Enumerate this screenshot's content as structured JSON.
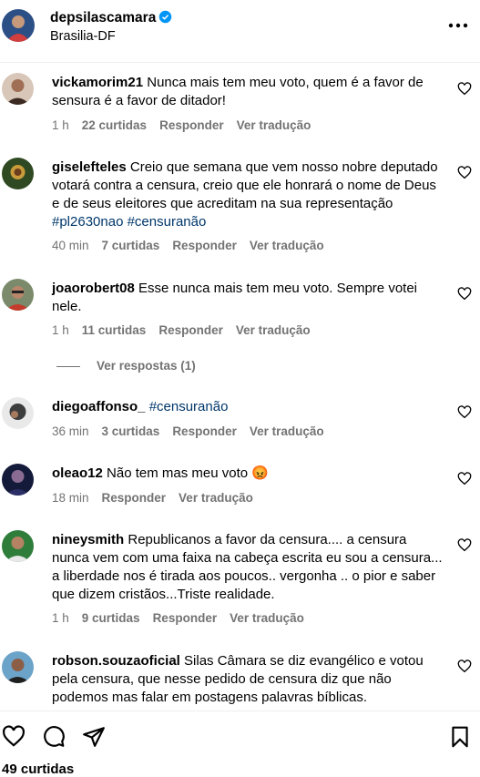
{
  "header": {
    "username": "depsilascamara",
    "location": "Brasilia-DF"
  },
  "comments": [
    {
      "user": "vickamorim21",
      "text": "Nunca mais tem meu voto, quem é a favor de sensura é a favor de ditador!",
      "time": "1 h",
      "likes": "22 curtidas",
      "reply": "Responder",
      "translate": "Ver tradução"
    },
    {
      "user": "giselefteles",
      "text": "Creio que semana que vem nosso nobre deputado votará contra a censura, creio que ele honrará o nome de Deus e de seus eleitores que acreditam na sua representação",
      "tags": "#pl2630nao #censuranão",
      "time": "40 min",
      "likes": "7 curtidas",
      "reply": "Responder",
      "translate": "Ver tradução"
    },
    {
      "user": "joaorobert08",
      "text": "Esse nunca mais tem meu voto. Sempre votei nele.",
      "time": "1 h",
      "likes": "11 curtidas",
      "reply": "Responder",
      "translate": "Ver tradução",
      "view_replies": "Ver respostas (1)"
    },
    {
      "user": "diegoaffonso_",
      "tags": "#censuranão",
      "time": "36 min",
      "likes": "3 curtidas",
      "reply": "Responder",
      "translate": "Ver tradução"
    },
    {
      "user": "oleao12",
      "text": "Não tem mas meu voto 😡",
      "time": "18 min",
      "reply": "Responder",
      "translate": "Ver tradução"
    },
    {
      "user": "nineysmith",
      "text": "Republicanos a favor da censura.... a censura nunca vem com uma faixa na cabeça escrita eu sou a censura... a liberdade nos é tirada aos poucos.. vergonha .. o pior e saber que dizem cristãos...Triste realidade.",
      "time": "1 h",
      "likes": "9 curtidas",
      "reply": "Responder",
      "translate": "Ver tradução"
    },
    {
      "user": "robson.souzaoficial",
      "text": "Silas Câmara se diz evangélico e votou pela censura, que nesse pedido de censura diz que não podemos mas falar em postagens palavras bíblicas."
    }
  ],
  "footer": {
    "likes": "49 curtidas"
  },
  "colors": {
    "link": "#00376b",
    "meta": "#737373",
    "verified": "#0095f6"
  }
}
